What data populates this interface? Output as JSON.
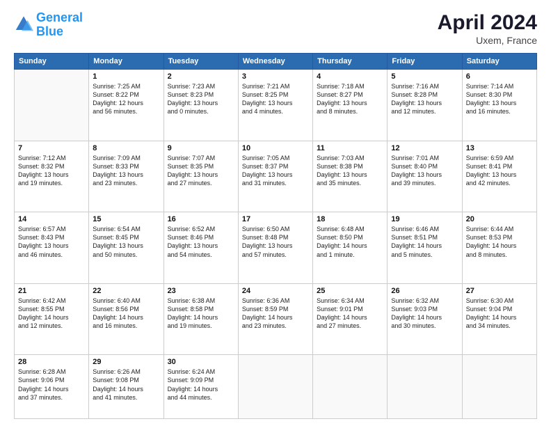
{
  "header": {
    "logo_line1": "General",
    "logo_line2": "Blue",
    "month": "April 2024",
    "location": "Uxem, France"
  },
  "weekdays": [
    "Sunday",
    "Monday",
    "Tuesday",
    "Wednesday",
    "Thursday",
    "Friday",
    "Saturday"
  ],
  "weeks": [
    [
      {
        "day": "",
        "detail": ""
      },
      {
        "day": "1",
        "detail": "Sunrise: 7:25 AM\nSunset: 8:22 PM\nDaylight: 12 hours\nand 56 minutes."
      },
      {
        "day": "2",
        "detail": "Sunrise: 7:23 AM\nSunset: 8:23 PM\nDaylight: 13 hours\nand 0 minutes."
      },
      {
        "day": "3",
        "detail": "Sunrise: 7:21 AM\nSunset: 8:25 PM\nDaylight: 13 hours\nand 4 minutes."
      },
      {
        "day": "4",
        "detail": "Sunrise: 7:18 AM\nSunset: 8:27 PM\nDaylight: 13 hours\nand 8 minutes."
      },
      {
        "day": "5",
        "detail": "Sunrise: 7:16 AM\nSunset: 8:28 PM\nDaylight: 13 hours\nand 12 minutes."
      },
      {
        "day": "6",
        "detail": "Sunrise: 7:14 AM\nSunset: 8:30 PM\nDaylight: 13 hours\nand 16 minutes."
      }
    ],
    [
      {
        "day": "7",
        "detail": "Sunrise: 7:12 AM\nSunset: 8:32 PM\nDaylight: 13 hours\nand 19 minutes."
      },
      {
        "day": "8",
        "detail": "Sunrise: 7:09 AM\nSunset: 8:33 PM\nDaylight: 13 hours\nand 23 minutes."
      },
      {
        "day": "9",
        "detail": "Sunrise: 7:07 AM\nSunset: 8:35 PM\nDaylight: 13 hours\nand 27 minutes."
      },
      {
        "day": "10",
        "detail": "Sunrise: 7:05 AM\nSunset: 8:37 PM\nDaylight: 13 hours\nand 31 minutes."
      },
      {
        "day": "11",
        "detail": "Sunrise: 7:03 AM\nSunset: 8:38 PM\nDaylight: 13 hours\nand 35 minutes."
      },
      {
        "day": "12",
        "detail": "Sunrise: 7:01 AM\nSunset: 8:40 PM\nDaylight: 13 hours\nand 39 minutes."
      },
      {
        "day": "13",
        "detail": "Sunrise: 6:59 AM\nSunset: 8:41 PM\nDaylight: 13 hours\nand 42 minutes."
      }
    ],
    [
      {
        "day": "14",
        "detail": "Sunrise: 6:57 AM\nSunset: 8:43 PM\nDaylight: 13 hours\nand 46 minutes."
      },
      {
        "day": "15",
        "detail": "Sunrise: 6:54 AM\nSunset: 8:45 PM\nDaylight: 13 hours\nand 50 minutes."
      },
      {
        "day": "16",
        "detail": "Sunrise: 6:52 AM\nSunset: 8:46 PM\nDaylight: 13 hours\nand 54 minutes."
      },
      {
        "day": "17",
        "detail": "Sunrise: 6:50 AM\nSunset: 8:48 PM\nDaylight: 13 hours\nand 57 minutes."
      },
      {
        "day": "18",
        "detail": "Sunrise: 6:48 AM\nSunset: 8:50 PM\nDaylight: 14 hours\nand 1 minute."
      },
      {
        "day": "19",
        "detail": "Sunrise: 6:46 AM\nSunset: 8:51 PM\nDaylight: 14 hours\nand 5 minutes."
      },
      {
        "day": "20",
        "detail": "Sunrise: 6:44 AM\nSunset: 8:53 PM\nDaylight: 14 hours\nand 8 minutes."
      }
    ],
    [
      {
        "day": "21",
        "detail": "Sunrise: 6:42 AM\nSunset: 8:55 PM\nDaylight: 14 hours\nand 12 minutes."
      },
      {
        "day": "22",
        "detail": "Sunrise: 6:40 AM\nSunset: 8:56 PM\nDaylight: 14 hours\nand 16 minutes."
      },
      {
        "day": "23",
        "detail": "Sunrise: 6:38 AM\nSunset: 8:58 PM\nDaylight: 14 hours\nand 19 minutes."
      },
      {
        "day": "24",
        "detail": "Sunrise: 6:36 AM\nSunset: 8:59 PM\nDaylight: 14 hours\nand 23 minutes."
      },
      {
        "day": "25",
        "detail": "Sunrise: 6:34 AM\nSunset: 9:01 PM\nDaylight: 14 hours\nand 27 minutes."
      },
      {
        "day": "26",
        "detail": "Sunrise: 6:32 AM\nSunset: 9:03 PM\nDaylight: 14 hours\nand 30 minutes."
      },
      {
        "day": "27",
        "detail": "Sunrise: 6:30 AM\nSunset: 9:04 PM\nDaylight: 14 hours\nand 34 minutes."
      }
    ],
    [
      {
        "day": "28",
        "detail": "Sunrise: 6:28 AM\nSunset: 9:06 PM\nDaylight: 14 hours\nand 37 minutes."
      },
      {
        "day": "29",
        "detail": "Sunrise: 6:26 AM\nSunset: 9:08 PM\nDaylight: 14 hours\nand 41 minutes."
      },
      {
        "day": "30",
        "detail": "Sunrise: 6:24 AM\nSunset: 9:09 PM\nDaylight: 14 hours\nand 44 minutes."
      },
      {
        "day": "",
        "detail": ""
      },
      {
        "day": "",
        "detail": ""
      },
      {
        "day": "",
        "detail": ""
      },
      {
        "day": "",
        "detail": ""
      }
    ]
  ]
}
